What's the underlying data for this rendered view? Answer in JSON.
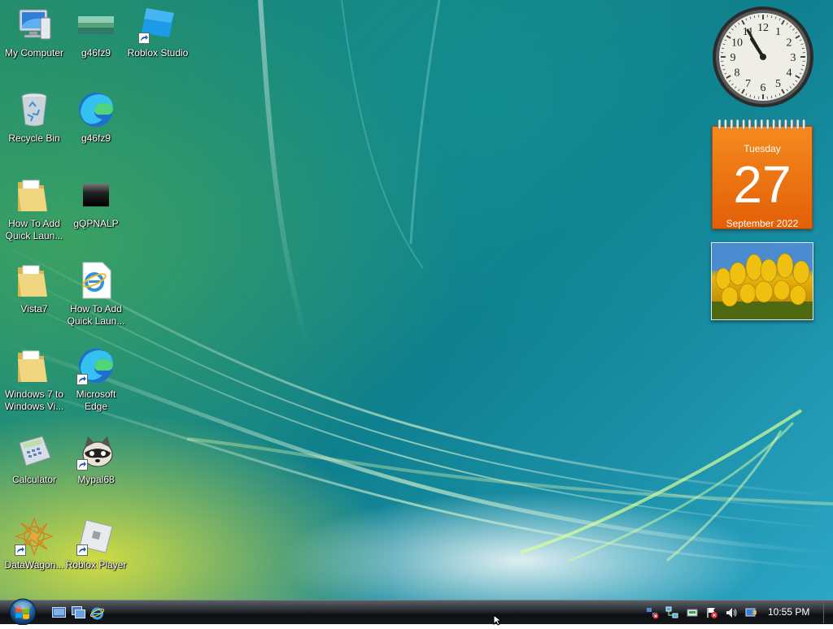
{
  "desktop_icons": [
    {
      "label": "My Computer",
      "icon": "computer-icon",
      "shortcut": false
    },
    {
      "label": "g46fz9",
      "icon": "image-thumbnail-icon",
      "shortcut": false
    },
    {
      "label": "Roblox Studio",
      "icon": "roblox-studio-icon",
      "shortcut": true
    },
    {
      "label": "Recycle Bin",
      "icon": "recycle-bin-icon",
      "shortcut": false
    },
    {
      "label": "g46fz9",
      "icon": "edge-icon",
      "shortcut": false
    },
    {
      "label": "How To Add\nQuick Laun...",
      "icon": "folder-icon",
      "shortcut": false
    },
    {
      "label": "gQPNALP",
      "icon": "black-thumbnail-icon",
      "shortcut": false
    },
    {
      "label": "Vista7",
      "icon": "folder-icon",
      "shortcut": false
    },
    {
      "label": "How To Add\nQuick Laun...",
      "icon": "ie-document-icon",
      "shortcut": false
    },
    {
      "label": "Windows 7 to\nWindows Vi...",
      "icon": "folder-icon",
      "shortcut": false
    },
    {
      "label": "Microsoft\nEdge",
      "icon": "edge-icon",
      "shortcut": true
    },
    {
      "label": "Calculator",
      "icon": "calculator-icon",
      "shortcut": false
    },
    {
      "label": "Mypal68",
      "icon": "raccoon-icon",
      "shortcut": true
    },
    {
      "label": "DataWagon...",
      "icon": "datawagon-icon",
      "shortcut": true
    },
    {
      "label": "Roblox Player",
      "icon": "roblox-player-icon",
      "shortcut": true
    }
  ],
  "gadgets": {
    "clock": {
      "hour": 10,
      "minute": 55,
      "numerals": [
        "12",
        "1",
        "2",
        "3",
        "4",
        "5",
        "6",
        "7",
        "8",
        "9",
        "10",
        "11"
      ]
    },
    "calendar": {
      "weekday": "Tuesday",
      "day": "27",
      "month_year": "September 2022"
    },
    "slideshow": {
      "subject": "yellow tulips"
    }
  },
  "taskbar": {
    "start_icon": "windows-orb-icon",
    "quick_launch": [
      "show-desktop-icon",
      "switch-windows-icon",
      "internet-explorer-icon"
    ],
    "tray_icons": [
      "network-error-icon",
      "network-icon",
      "safely-remove-hardware-icon",
      "action-center-error-icon",
      "volume-icon",
      "windows-update-icon"
    ],
    "time": "10:55 PM"
  },
  "colors": {
    "calendar_orange": "#e8680c",
    "taskbar": "#1a1d21"
  }
}
